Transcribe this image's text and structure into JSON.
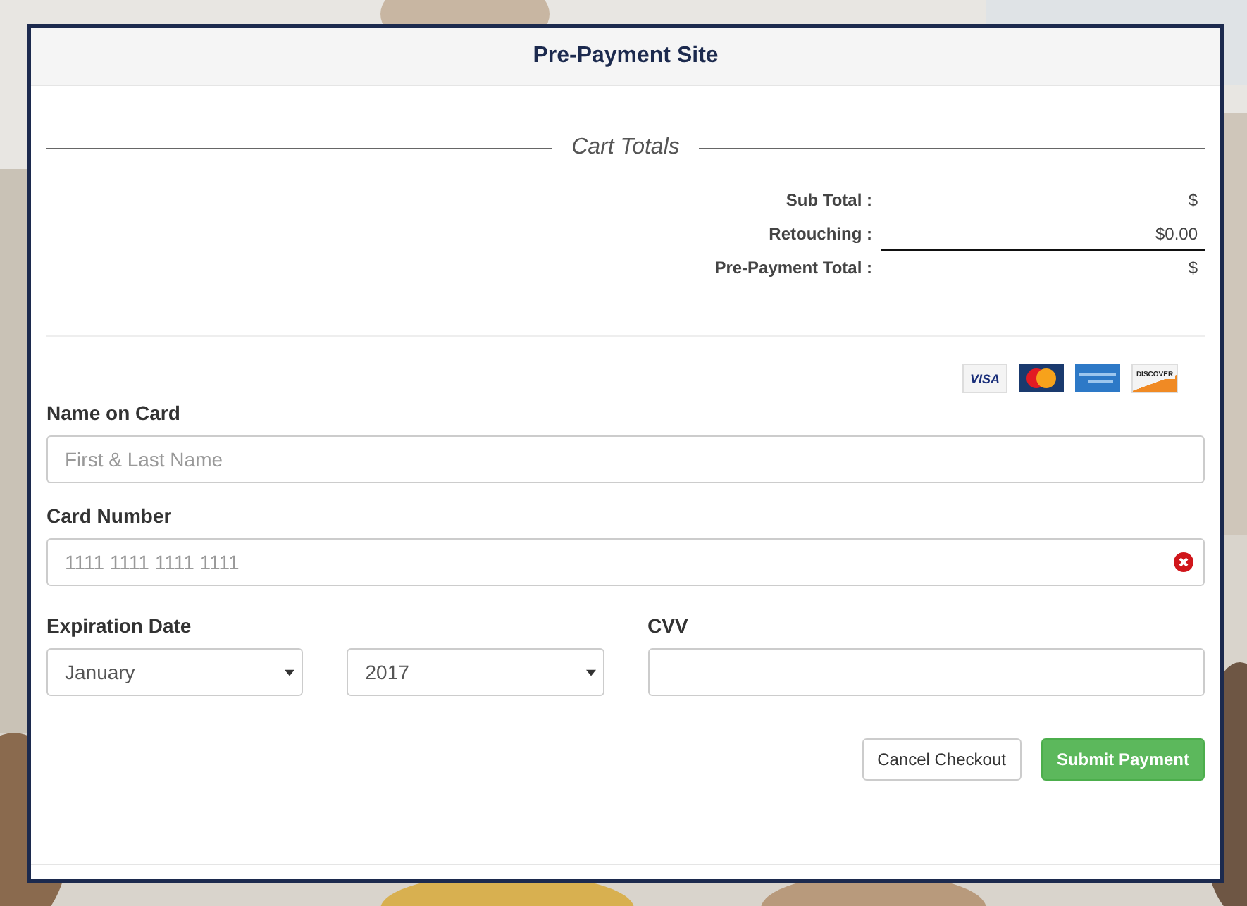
{
  "modal": {
    "title": "Pre-Payment Site"
  },
  "cart_totals": {
    "heading": "Cart Totals",
    "rows": [
      {
        "label": "Sub Total :",
        "value": "$",
        "underlined": false
      },
      {
        "label": "Retouching :",
        "value": "$0.00",
        "underlined": true
      },
      {
        "label": "Pre-Payment Total :",
        "value": "$",
        "underlined": false
      }
    ]
  },
  "card_logos": [
    {
      "kind": "visa",
      "label": "VISA"
    },
    {
      "kind": "mastercard"
    },
    {
      "kind": "amex"
    },
    {
      "kind": "discover",
      "label": "DISCOVER"
    }
  ],
  "form": {
    "name_on_card": {
      "label": "Name on Card",
      "placeholder": "First & Last Name",
      "error": false
    },
    "card_number": {
      "label": "Card Number",
      "placeholder": "1111 1111 1111 1111",
      "error": true
    },
    "expiration": {
      "label": "Expiration Date",
      "month": "January",
      "year": "2017"
    },
    "cvv": {
      "label": "CVV"
    }
  },
  "buttons": [
    {
      "kind": "secondary",
      "label": "Cancel Checkout"
    },
    {
      "kind": "primary",
      "label": "Submit Payment"
    }
  ]
}
